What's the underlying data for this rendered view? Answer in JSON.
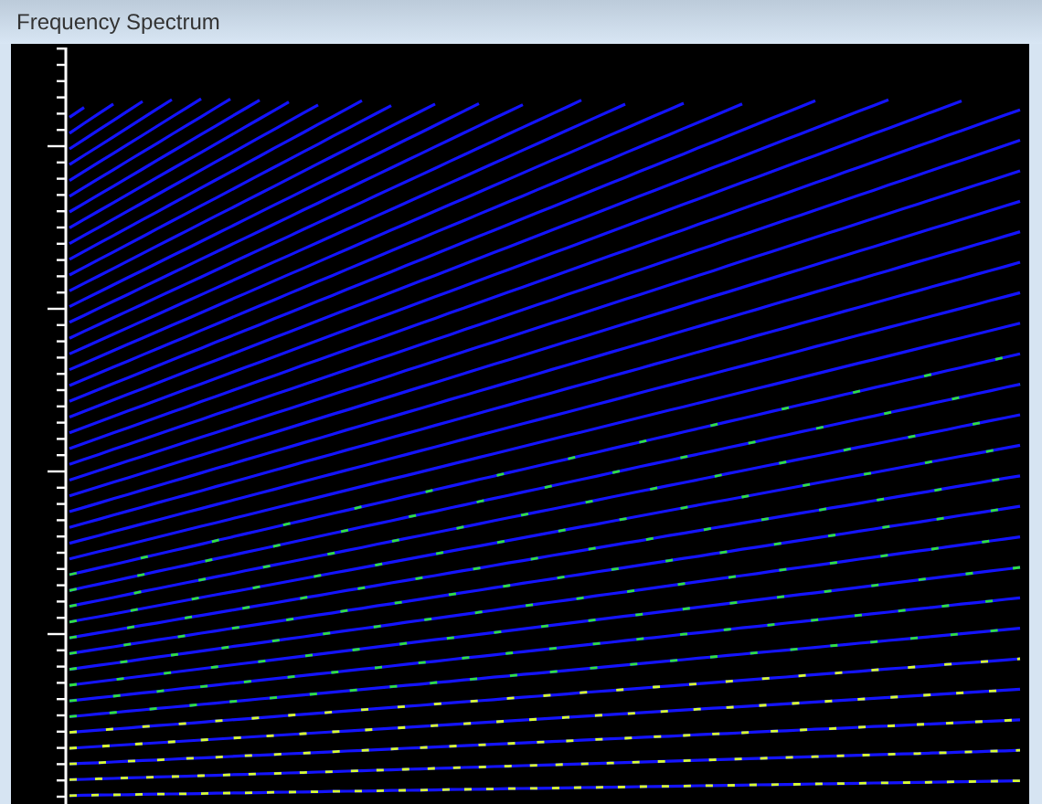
{
  "window": {
    "title": "Frequency Spectrum"
  }
}
